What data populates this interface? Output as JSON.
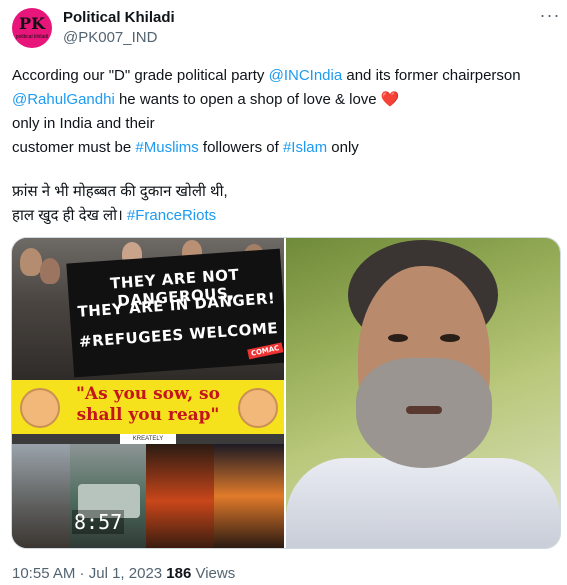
{
  "author": {
    "display_name": "Political Khiladi",
    "handle": "@PK007_IND",
    "avatar_text": "PK",
    "avatar_subtext": "political khiladi"
  },
  "tweet": {
    "para1": {
      "t1": "According our \"D\" grade  political party ",
      "mention1": "@INCIndia",
      "t2": " and its former chairperson ",
      "mention2": "@RahulGandhi",
      "t3": " he wants to open a shop of love & love ",
      "emoji": "❤️",
      "t4": "only in India and their",
      "t5": "customer must be ",
      "hashtag1": "#Muslims",
      "t6": " followers of ",
      "hashtag2": "#Islam",
      "t7": " only"
    },
    "para2": {
      "line1": "फ्रांस ने भी मोहब्बत की दुकान खोली थी,",
      "line2": "हाल खुद ही देख लो। ",
      "hashtag": "#FranceRiots"
    }
  },
  "media": {
    "collage": {
      "banner_line1": "THEY ARE NOT DANGEROUS,",
      "banner_line2": "THEY ARE IN DANGER!",
      "banner_line3": "#REFUGEES WELCOME",
      "banner_tag": "COMAC",
      "quote_line1": "\"As you sow, so",
      "quote_line2": "shall you reap\"",
      "watermark": "KREATELY",
      "clock": "8:57"
    }
  },
  "footer": {
    "time": "10:55 AM",
    "separator": " · ",
    "date": "Jul 1, 2023",
    "views_count": "186",
    "views_label": " Views"
  },
  "colors": {
    "link": "#1d9bf0",
    "text": "#0f1419",
    "muted": "#536471",
    "avatar_bg": "#e8157a",
    "heart": "#e0245e"
  },
  "icons": {
    "more": "more-horizontal-icon"
  }
}
